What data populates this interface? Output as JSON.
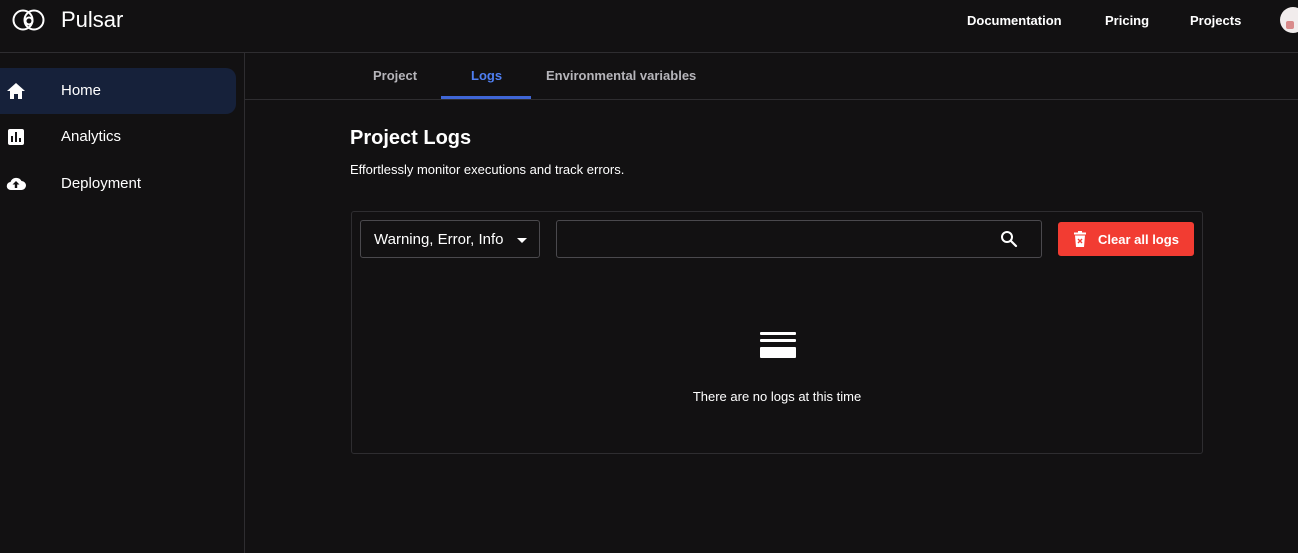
{
  "header": {
    "brand": "Pulsar",
    "nav": [
      "Documentation",
      "Pricing",
      "Projects"
    ]
  },
  "sidebar": {
    "items": [
      {
        "label": "Home",
        "icon": "home-icon",
        "active": true
      },
      {
        "label": "Analytics",
        "icon": "analytics-icon",
        "active": false
      },
      {
        "label": "Deployment",
        "icon": "cloud-upload-icon",
        "active": false
      }
    ]
  },
  "tabs": [
    {
      "label": "Project",
      "active": false
    },
    {
      "label": "Logs",
      "active": true
    },
    {
      "label": "Environmental variables",
      "active": false
    }
  ],
  "main": {
    "title": "Project Logs",
    "subtitle": "Effortlessly monitor executions and track errors.",
    "filter_value": "Warning, Error, Info",
    "search_value": "",
    "clear_label": "Clear all logs",
    "empty_text": "There are no logs at this time"
  },
  "colors": {
    "background": "#121112",
    "accent": "#4f7ff2",
    "danger": "#f23c32",
    "active_sidebar": "#16213a"
  }
}
